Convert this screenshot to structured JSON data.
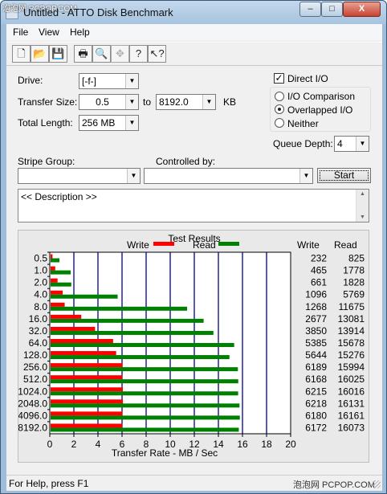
{
  "watermark_top": "泡泡网 PCPOP.COM",
  "window": {
    "title": "Untitled - ATTO Disk Benchmark",
    "minimize": "–",
    "maximize": "□",
    "close": "X"
  },
  "menu": [
    "File",
    "View",
    "Help"
  ],
  "toolbar_icons": [
    "new-file-icon",
    "open-folder-icon",
    "save-icon",
    "print-icon",
    "print-preview-icon",
    "move-icon",
    "help-icon",
    "context-help-icon"
  ],
  "toolbar_glyphs": [
    "🗋",
    "📂",
    "💾",
    "🖶",
    "🔍",
    "✥",
    "?",
    "↖?"
  ],
  "drive": {
    "label": "Drive:",
    "value": "[-f-]"
  },
  "transfer_size": {
    "label": "Transfer Size:",
    "from": "0.5",
    "to_label": "to",
    "to": "8192.0",
    "unit": "KB"
  },
  "total_length": {
    "label": "Total Length:",
    "value": "256 MB"
  },
  "options": {
    "direct_io": "Direct I/O",
    "direct_io_checked": true,
    "io_comparison": "I/O Comparison",
    "overlapped_io": "Overlapped I/O",
    "neither": "Neither",
    "selected": "overlapped_io",
    "queue_depth_label": "Queue Depth:",
    "queue_depth": "4"
  },
  "stripe_group_label": "Stripe Group:",
  "controlled_by_label": "Controlled by:",
  "start_label": "Start",
  "description": "<< Description >>",
  "results": {
    "title": "Test Results",
    "write_legend": "Write",
    "read_legend": "Read",
    "write_col": "Write",
    "read_col": "Read",
    "xlabel": "Transfer Rate - MB / Sec"
  },
  "chart_data": {
    "type": "bar",
    "title": "Test Results",
    "xlabel": "Transfer Rate - MB / Sec",
    "ylabel": "",
    "xlim": [
      0,
      20
    ],
    "xticks": [
      0,
      2,
      4,
      6,
      8,
      10,
      12,
      14,
      16,
      18,
      20
    ],
    "categories": [
      "0.5",
      "1.0",
      "2.0",
      "4.0",
      "8.0",
      "16.0",
      "32.0",
      "64.0",
      "128.0",
      "256.0",
      "512.0",
      "1024.0",
      "2048.0",
      "4096.0",
      "8192.0"
    ],
    "series": [
      {
        "name": "Write",
        "color": "#ff0000",
        "values": [
          232,
          465,
          661,
          1096,
          1268,
          2677,
          3850,
          5385,
          5644,
          6189,
          6168,
          6215,
          6218,
          6180,
          6172
        ]
      },
      {
        "name": "Read",
        "color": "#008000",
        "values": [
          825,
          1778,
          1828,
          5769,
          11675,
          13081,
          13914,
          15678,
          15276,
          15994,
          16025,
          16016,
          16131,
          16161,
          16073
        ]
      }
    ],
    "bar_scale_note": ""
  },
  "status": {
    "text": "For Help, press F1",
    "watermark": "泡泡网 PCPOP.COM"
  }
}
